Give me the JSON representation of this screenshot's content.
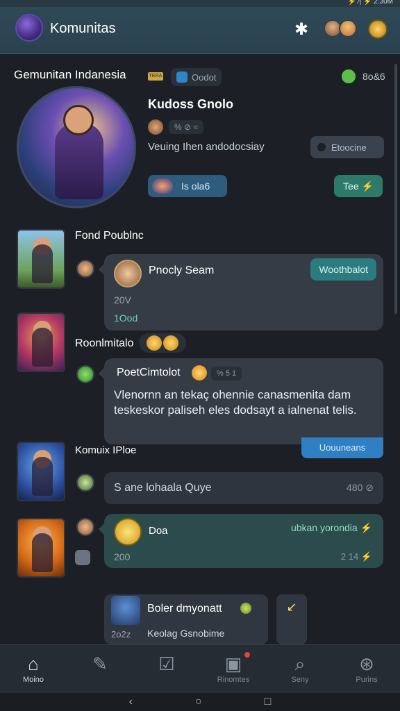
{
  "status": {
    "text": "⚡ ⁄| ⚡ 2:30M"
  },
  "header": {
    "title": "Komunitas",
    "star_icon": "star-icon"
  },
  "featured": {
    "community": "Gemunitan Indanesia",
    "gold_tag": "TERA",
    "id_label": "Oodot",
    "online_count": "8o&6",
    "name": "Kudoss Gnolo",
    "meta_chip": "% ⊘ ≈",
    "description": "Veuing Ihen andodocsiay",
    "dark_button": "Etoocine",
    "join_label": "Is ola6",
    "tee_label": "Tee ⚡"
  },
  "feed": [
    {
      "label": "Fond Poublnc",
      "author": "Pnocly Seam",
      "chip": "Woothbalot",
      "count": "20V",
      "link": "1Ood",
      "reaction_label": "Roonlmitalo"
    },
    {
      "author": "PoetCimtolot",
      "chip": "% 5 1",
      "text": "Vlenornn an tekaç ohennie canasmenita dam teskeskor paliseh eles dodsayt a ialnenat telis.",
      "tab": "Uouuneans"
    },
    {
      "label": "Komuix IPloe",
      "text": "S ane lohaala Quye",
      "right": "480 ⊘"
    },
    {
      "name": "Doa",
      "tag": "ubkan yorondia ⚡",
      "n1": "200",
      "n2": "2 14 ⚡"
    },
    {
      "name": "Boler dmyonatt",
      "n": "2o2z",
      "sub": "Keolag Gsnobime"
    }
  ],
  "nav": [
    {
      "label": "Moino",
      "icon": "home-icon"
    },
    {
      "label": "",
      "icon": "pencil-icon"
    },
    {
      "label": "",
      "icon": "check-icon"
    },
    {
      "label": "Rinomtes",
      "icon": "inbox-icon"
    },
    {
      "label": "Seny",
      "icon": "search-icon"
    },
    {
      "label": "Purins",
      "icon": "profile-icon"
    }
  ]
}
